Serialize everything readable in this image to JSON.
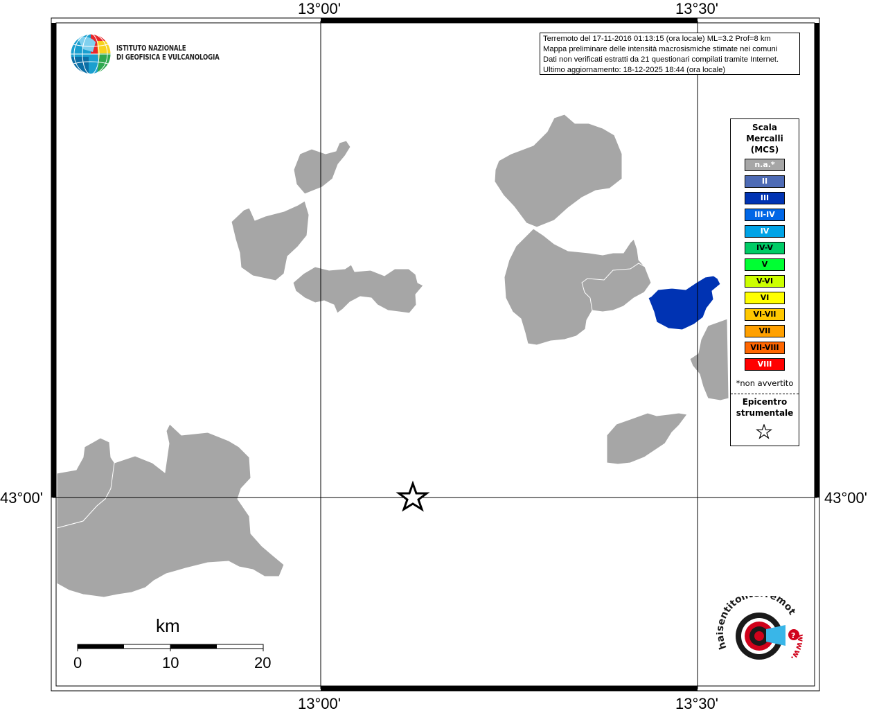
{
  "map": {
    "top_axis_labels": [
      "13°00'",
      "13°30'"
    ],
    "bottom_axis_labels": [
      "13°00'",
      "13°30'"
    ],
    "left_axis_label": "43°00'",
    "right_axis_label": "43°00'"
  },
  "info_box": {
    "lines": [
      "Terremoto del 17-11-2016 01:13:15 (ora locale) ML=3.2 Prof=8 km",
      "Mappa preliminare delle intensità macrosismiche stimate nei comuni",
      "Dati non verificati estratti da 21 questionari compilati tramite Internet.",
      "Ultimo aggiornamento: 18-12-2025 18:44 (ora locale)"
    ]
  },
  "ingv_logo": {
    "line1": "ISTITUTO NAZIONALE",
    "line2": "DI GEOFISICA E VULCANOLOGIA"
  },
  "legend": {
    "title_line1": "Scala",
    "title_line2": "Mercalli",
    "title_line3": "(MCS)",
    "items": [
      {
        "label": "n.a.*",
        "color": "#a6a6a6",
        "text_color": "#ffffff"
      },
      {
        "label": "II",
        "color": "#4e6bb5",
        "text_color": "#ffffff"
      },
      {
        "label": "III",
        "color": "#0033b3",
        "text_color": "#ffffff"
      },
      {
        "label": "III-IV",
        "color": "#0066e6",
        "text_color": "#ffffff"
      },
      {
        "label": "IV",
        "color": "#00a3e6",
        "text_color": "#ffffff"
      },
      {
        "label": "IV-V",
        "color": "#00cc66",
        "text_color": "#000000"
      },
      {
        "label": "V",
        "color": "#00ff33",
        "text_color": "#000000"
      },
      {
        "label": "V-VI",
        "color": "#ccff00",
        "text_color": "#000000"
      },
      {
        "label": "VI",
        "color": "#ffff00",
        "text_color": "#000000"
      },
      {
        "label": "VI-VII",
        "color": "#ffc800",
        "text_color": "#000000"
      },
      {
        "label": "VII",
        "color": "#ffa000",
        "text_color": "#000000"
      },
      {
        "label": "VII-VIII",
        "color": "#ff6600",
        "text_color": "#000000"
      },
      {
        "label": "VIII",
        "color": "#ff0000",
        "text_color": "#ffffff"
      }
    ],
    "footnote": "*non avvertito",
    "epicenter_line1": "Epicentro",
    "epicenter_line2": "strumentale"
  },
  "scale_bar": {
    "unit": "km",
    "ticks": [
      "0",
      "10",
      "20"
    ]
  },
  "municipalities": [
    {
      "intensity": "n.a.*",
      "color": "#a6a6a6"
    },
    {
      "intensity": "III",
      "color": "#0033b3"
    }
  ],
  "hsit_logo": {
    "text": "haisentitoilterremoto.it",
    "url_text": "www."
  }
}
